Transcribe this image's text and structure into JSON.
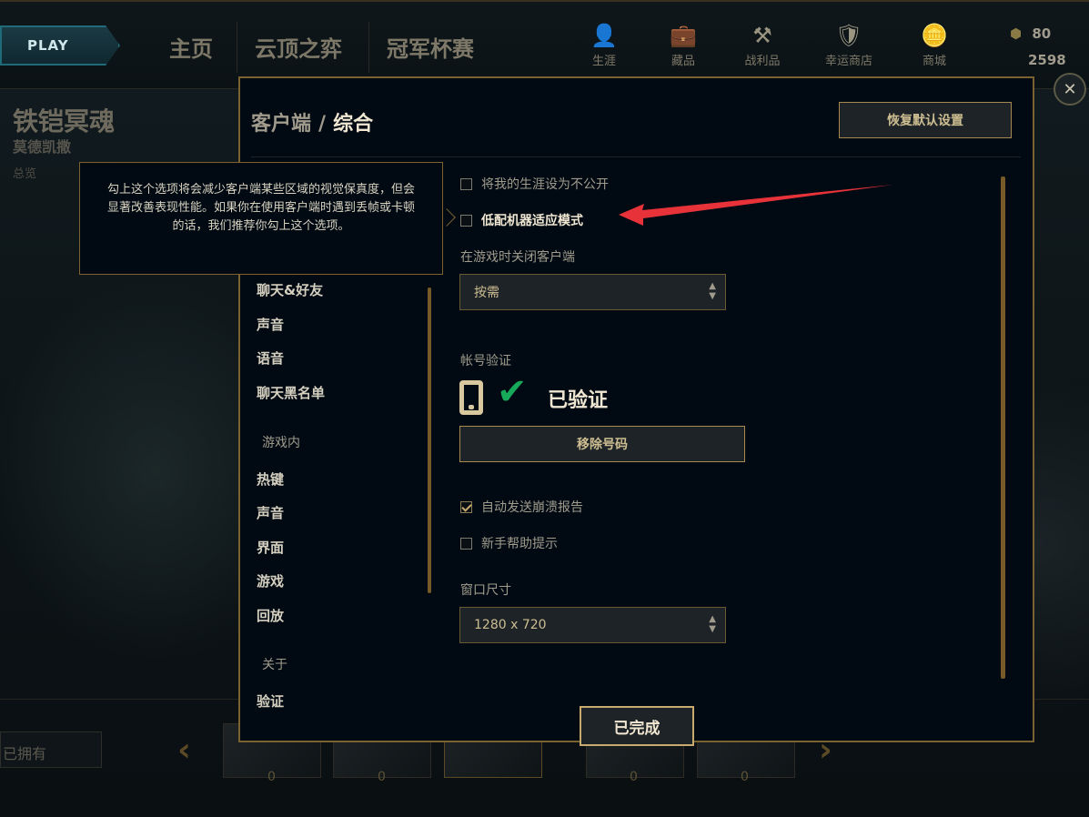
{
  "topbar": {
    "play_label": "PLAY",
    "nav": [
      "主页",
      "云顶之弈",
      "冠军杯赛"
    ],
    "icons": [
      {
        "name": "profile-icon",
        "glyph": "👤",
        "label": "生涯"
      },
      {
        "name": "collection-icon",
        "glyph": "💼",
        "label": "藏品"
      },
      {
        "name": "loot-icon",
        "glyph": "⚒",
        "label": "战利品"
      },
      {
        "name": "lucky-shop-icon",
        "glyph": "🛡",
        "label": "幸运商店"
      },
      {
        "name": "store-icon",
        "glyph": "🪙",
        "label": "商城"
      }
    ],
    "rp": "80",
    "be": "2598",
    "close_glyph": "✕"
  },
  "background": {
    "champion_name": "铁铠冥魂",
    "champion_title": "莫德凯撒",
    "tab": "总览",
    "owned_filter": "已拥有",
    "thumb_counts": [
      "0",
      "0",
      "0",
      "0"
    ]
  },
  "modal": {
    "breadcrumb_parent": "客户端",
    "breadcrumb_sep": "/",
    "breadcrumb_current": "综合",
    "reset_label": "恢复默认设置",
    "sidebar": {
      "client_items": [
        "聊天&好友",
        "声音",
        "语音",
        "聊天黑名单"
      ],
      "ingame_group": "游戏内",
      "ingame_items": [
        "热键",
        "声音",
        "界面",
        "游戏",
        "回放"
      ],
      "about_group": "关于",
      "about_items": [
        "验证"
      ]
    },
    "options": {
      "private_career": {
        "label": "将我的生涯设为不公开",
        "checked": false
      },
      "low_spec": {
        "label": "低配机器适应模式",
        "checked": false
      },
      "close_client_label": "在游戏时关闭客户端",
      "close_client_value": "按需",
      "account_verify_label": "帐号验证",
      "verified_text": "已验证",
      "remove_number_label": "移除号码",
      "crash_report": {
        "label": "自动发送崩溃报告",
        "checked": true
      },
      "newbie_tips": {
        "label": "新手帮助提示",
        "checked": false
      },
      "window_size_label": "窗口尺寸",
      "window_size_value": "1280 x 720"
    },
    "done_label": "已完成"
  },
  "tooltip": {
    "text": "勾上这个选项将会减少客户端某些区域的视觉保真度，但会显著改善表现性能。如果你在使用客户端时遇到丢帧或卡顿的话，我们推荐你勾上这个选项。"
  },
  "colors": {
    "gold": "#c8aa6e",
    "modal_bg": "#010a13",
    "check_green": "#17a85a",
    "annotation_red": "#e8323a"
  }
}
